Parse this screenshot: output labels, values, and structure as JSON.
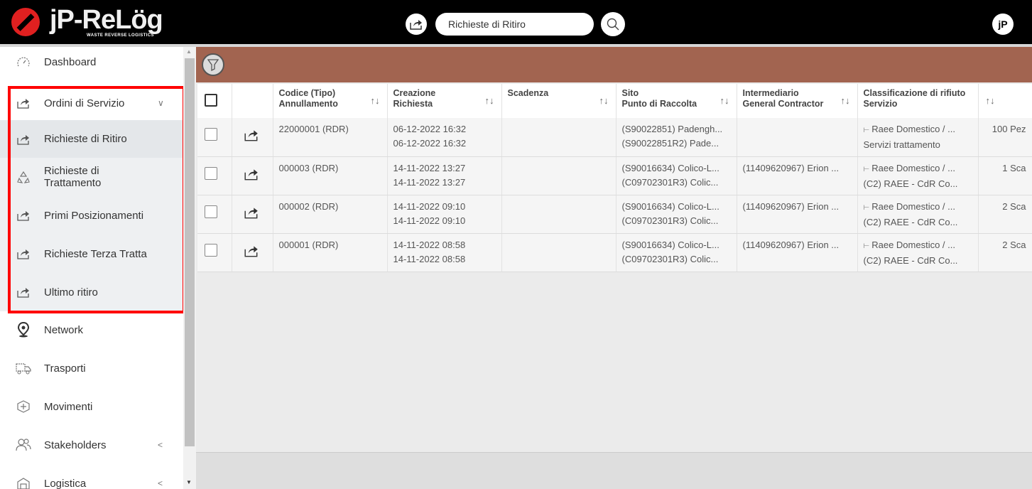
{
  "app": {
    "logo": "jP-ReLög",
    "logo_subtitle": "WASTE REVERSE LOGISTICS",
    "avatar_text": "jP"
  },
  "search": {
    "value": "Richieste di Ritiro"
  },
  "sidebar": {
    "items": [
      {
        "label": "Dashboard",
        "icon": "gauge-icon"
      },
      {
        "label": "Ordini di Servizio",
        "icon": "share-icon",
        "chevron": "∨"
      },
      {
        "label": "Richieste di Ritiro",
        "icon": "share-icon"
      },
      {
        "label": "Richieste di Trattamento",
        "icon": "recycle-icon"
      },
      {
        "label": "Primi Posizionamenti",
        "icon": "share-icon"
      },
      {
        "label": "Richieste Terza Tratta",
        "icon": "share-icon"
      },
      {
        "label": "Ultimo ritiro",
        "icon": "share-icon"
      },
      {
        "label": "Network",
        "icon": "location-pin-icon"
      },
      {
        "label": "Trasporti",
        "icon": "truck-icon"
      },
      {
        "label": "Movimenti",
        "icon": "box-move-icon"
      },
      {
        "label": "Stakeholders",
        "icon": "users-icon",
        "chevron": "<"
      },
      {
        "label": "Logistica",
        "icon": "warehouse-icon",
        "chevron": "<"
      }
    ]
  },
  "table": {
    "headers": [
      {
        "l1": "Codice (Tipo)",
        "l2": "Annullamento"
      },
      {
        "l1": "Creazione",
        "l2": "Richiesta"
      },
      {
        "l1": "Scadenza",
        "l2": ""
      },
      {
        "l1": "Sito",
        "l2": "Punto di Raccolta"
      },
      {
        "l1": "Intermediario",
        "l2": "General Contractor"
      },
      {
        "l1": "Classificazione di rifiuto",
        "l2": "Servizio"
      }
    ],
    "sort_glyph": "↑↓",
    "rows": [
      {
        "code": "22000001 (RDR)",
        "created1": "06-12-2022 16:32",
        "created2": "06-12-2022 16:32",
        "scadenza": "",
        "sito1": "(S90022851) Padengh...",
        "sito2": "(S90022851R2) Pade...",
        "inter": "",
        "class1": "Raee Domestico / ...",
        "class2": "Servizi trattamento",
        "qty": "100 Pez"
      },
      {
        "code": "000003 (RDR)",
        "created1": "14-11-2022 13:27",
        "created2": "14-11-2022 13:27",
        "scadenza": "",
        "sito1": "(S90016634) Colico-L...",
        "sito2": "(C09702301R3) Colic...",
        "inter": "(11409620967) Erion ...",
        "class1": "Raee Domestico / ...",
        "class2": "(C2) RAEE - CdR Co...",
        "qty": "1 Sca"
      },
      {
        "code": "000002 (RDR)",
        "created1": "14-11-2022 09:10",
        "created2": "14-11-2022 09:10",
        "scadenza": "",
        "sito1": "(S90016634) Colico-L...",
        "sito2": "(C09702301R3) Colic...",
        "inter": "(11409620967) Erion ...",
        "class1": "Raee Domestico / ...",
        "class2": "(C2) RAEE - CdR Co...",
        "qty": "2 Sca"
      },
      {
        "code": "000001 (RDR)",
        "created1": "14-11-2022 08:58",
        "created2": "14-11-2022 08:58",
        "scadenza": "",
        "sito1": "(S90016634) Colico-L...",
        "sito2": "(C09702301R3) Colic...",
        "inter": "(11409620967) Erion ...",
        "class1": "Raee Domestico / ...",
        "class2": "(C2) RAEE - CdR Co...",
        "qty": "2 Sca"
      }
    ]
  },
  "colors": {
    "topbar": "#000000",
    "filterbar": "#a26450",
    "highlight": "#ff0000",
    "logo_red": "#e02020"
  }
}
